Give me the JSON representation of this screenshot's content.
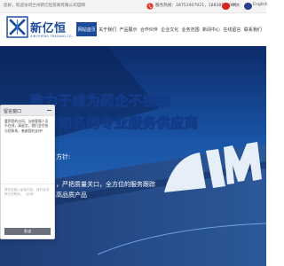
{
  "topbar": {
    "welcome": "您好，欢迎访问兰州新亿恒贸易有限公司官网",
    "phone_label": "服务热线：",
    "phone": "18751907021，18838507001",
    "lang_cn": "中文",
    "lang_en": "English"
  },
  "logo": {
    "name": "新亿恒",
    "english": "XINYIHENG TRADING CO."
  },
  "nav": {
    "items": [
      {
        "label": "网站首页"
      },
      {
        "label": "关于我们"
      },
      {
        "label": "产品展示"
      },
      {
        "label": "合作伙伴"
      },
      {
        "label": "企业文化"
      },
      {
        "label": "业务范围"
      },
      {
        "label": "新闻中心"
      },
      {
        "label": "在线留言"
      },
      {
        "label": "联系我们"
      }
    ]
  },
  "banner": {
    "headline1": "致力于成为药企不锈钢",
    "headline2": "领域知名的专业服务供应商",
    "line1": "方针:",
    "line2": "，严把质量关口，全方位的服务跟踪",
    "line3": "高品质产品"
  },
  "chat": {
    "title": "留言窗口",
    "message": "看到您的访问，当前客服人员不在线，请留言，我们会尽快与您联系，感谢您的支持！",
    "placeholder": "请在此输入留言内容，我们会尽快与您联系。（必填）",
    "send": "发送"
  },
  "colors": {
    "brand": "#1b4a9c",
    "headline": "#ffd54a"
  },
  "icons": {
    "phone": "phone-icon",
    "logo": "logo-mark-icon"
  }
}
